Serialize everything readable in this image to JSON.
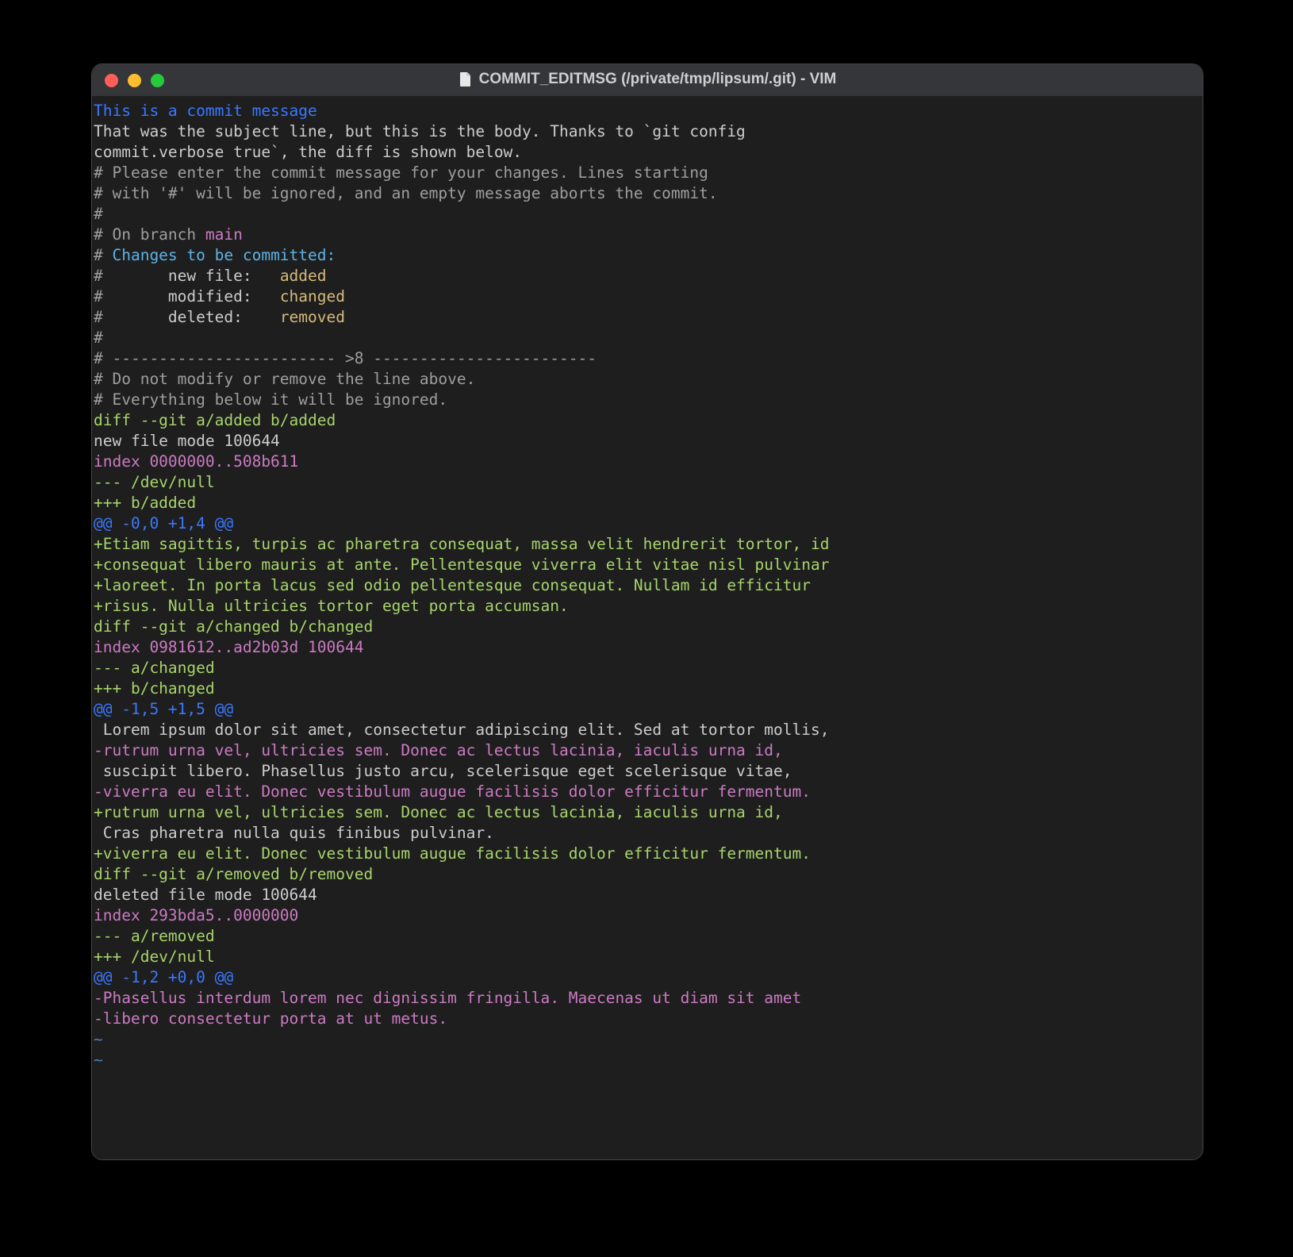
{
  "window": {
    "title": "COMMIT_EDITMSG (/private/tmp/lipsum/.git) - VIM"
  },
  "lines": [
    {
      "cls": "c-subject",
      "text": "This is a commit message"
    },
    {
      "cls": "c-body",
      "text": ""
    },
    {
      "cls": "c-body",
      "text": "That was the subject line, but this is the body. Thanks to `git config"
    },
    {
      "cls": "c-body",
      "text": "commit.verbose true`, the diff is shown below."
    },
    {
      "cls": "c-body",
      "text": ""
    },
    {
      "cls": "c-comment",
      "text": "# Please enter the commit message for your changes. Lines starting"
    },
    {
      "cls": "c-comment",
      "text": "# with '#' will be ignored, and an empty message aborts the commit."
    },
    {
      "cls": "c-comment",
      "text": "#"
    },
    {
      "segments": [
        {
          "cls": "c-comment",
          "text": "# On branch "
        },
        {
          "cls": "c-branch",
          "text": "main"
        }
      ]
    },
    {
      "segments": [
        {
          "cls": "c-comment",
          "text": "# "
        },
        {
          "cls": "c-changes",
          "text": "Changes to be committed:"
        }
      ]
    },
    {
      "segments": [
        {
          "cls": "c-comment",
          "text": "#       "
        },
        {
          "cls": "c-white",
          "text": "new file:   "
        },
        {
          "cls": "c-file",
          "text": "added"
        }
      ]
    },
    {
      "segments": [
        {
          "cls": "c-comment",
          "text": "#       "
        },
        {
          "cls": "c-white",
          "text": "modified:   "
        },
        {
          "cls": "c-file",
          "text": "changed"
        }
      ]
    },
    {
      "segments": [
        {
          "cls": "c-comment",
          "text": "#       "
        },
        {
          "cls": "c-white",
          "text": "deleted:    "
        },
        {
          "cls": "c-file",
          "text": "removed"
        }
      ]
    },
    {
      "cls": "c-comment",
      "text": "#"
    },
    {
      "cls": "c-comment",
      "text": "# ------------------------ >8 ------------------------"
    },
    {
      "cls": "c-comment",
      "text": "# Do not modify or remove the line above."
    },
    {
      "cls": "c-comment",
      "text": "# Everything below it will be ignored."
    },
    {
      "cls": "c-diffcmd",
      "text": "diff --git a/added b/added"
    },
    {
      "cls": "c-white",
      "text": "new file mode 100644"
    },
    {
      "cls": "c-index",
      "text": "index 0000000..508b611"
    },
    {
      "cls": "c-minusfile",
      "text": "--- /dev/null"
    },
    {
      "cls": "c-plusfile",
      "text": "+++ b/added"
    },
    {
      "cls": "c-hunk",
      "text": "@@ -0,0 +1,4 @@"
    },
    {
      "cls": "c-add",
      "text": "+Etiam sagittis, turpis ac pharetra consequat, massa velit hendrerit tortor, id"
    },
    {
      "cls": "c-add",
      "text": "+consequat libero mauris at ante. Pellentesque viverra elit vitae nisl pulvinar"
    },
    {
      "cls": "c-add",
      "text": "+laoreet. In porta lacus sed odio pellentesque consequat. Nullam id efficitur"
    },
    {
      "cls": "c-add",
      "text": "+risus. Nulla ultricies tortor eget porta accumsan."
    },
    {
      "cls": "c-diffcmd",
      "text": "diff --git a/changed b/changed"
    },
    {
      "cls": "c-index",
      "text": "index 0981612..ad2b03d 100644"
    },
    {
      "cls": "c-minusfile",
      "text": "--- a/changed"
    },
    {
      "cls": "c-plusfile",
      "text": "+++ b/changed"
    },
    {
      "cls": "c-hunk",
      "text": "@@ -1,5 +1,5 @@"
    },
    {
      "cls": "c-ctx",
      "text": " Lorem ipsum dolor sit amet, consectetur adipiscing elit. Sed at tortor mollis,"
    },
    {
      "cls": "c-del",
      "text": "-rutrum urna vel, ultricies sem. Donec ac lectus lacinia, iaculis urna id,"
    },
    {
      "cls": "c-ctx",
      "text": " suscipit libero. Phasellus justo arcu, scelerisque eget scelerisque vitae,"
    },
    {
      "cls": "c-del",
      "text": "-viverra eu elit. Donec vestibulum augue facilisis dolor efficitur fermentum."
    },
    {
      "cls": "c-add",
      "text": "+rutrum urna vel, ultricies sem. Donec ac lectus lacinia, iaculis urna id,"
    },
    {
      "cls": "c-ctx",
      "text": " Cras pharetra nulla quis finibus pulvinar."
    },
    {
      "cls": "c-add",
      "text": "+viverra eu elit. Donec vestibulum augue facilisis dolor efficitur fermentum."
    },
    {
      "cls": "c-diffcmd",
      "text": "diff --git a/removed b/removed"
    },
    {
      "cls": "c-white",
      "text": "deleted file mode 100644"
    },
    {
      "cls": "c-index",
      "text": "index 293bda5..0000000"
    },
    {
      "cls": "c-minusfile",
      "text": "--- a/removed"
    },
    {
      "cls": "c-plusfile",
      "text": "+++ /dev/null"
    },
    {
      "cls": "c-hunk",
      "text": "@@ -1,2 +0,0 @@"
    },
    {
      "cls": "c-del",
      "text": "-Phasellus interdum lorem nec dignissim fringilla. Maecenas ut diam sit amet"
    },
    {
      "cls": "c-del",
      "text": "-libero consectetur porta at ut metus."
    },
    {
      "cls": "c-tilde",
      "text": "~"
    },
    {
      "cls": "c-tilde",
      "text": "~"
    }
  ],
  "colors": {
    "bg": "#1e1e1e",
    "titlebar": "#35363a",
    "subject": "#3b78ff",
    "body": "#cccccc",
    "comment": "#9e9e9e",
    "branch": "#cc7ac3",
    "changes_header": "#5db3e6",
    "filename": "#d7ba7d",
    "diff_cmd": "#a7d46b",
    "index": "#cc7ac3",
    "hunk": "#3b78ff",
    "added": "#a7d46b",
    "deleted": "#cc7ac3",
    "context": "#cccccc",
    "tilde": "#4a7fbf"
  }
}
